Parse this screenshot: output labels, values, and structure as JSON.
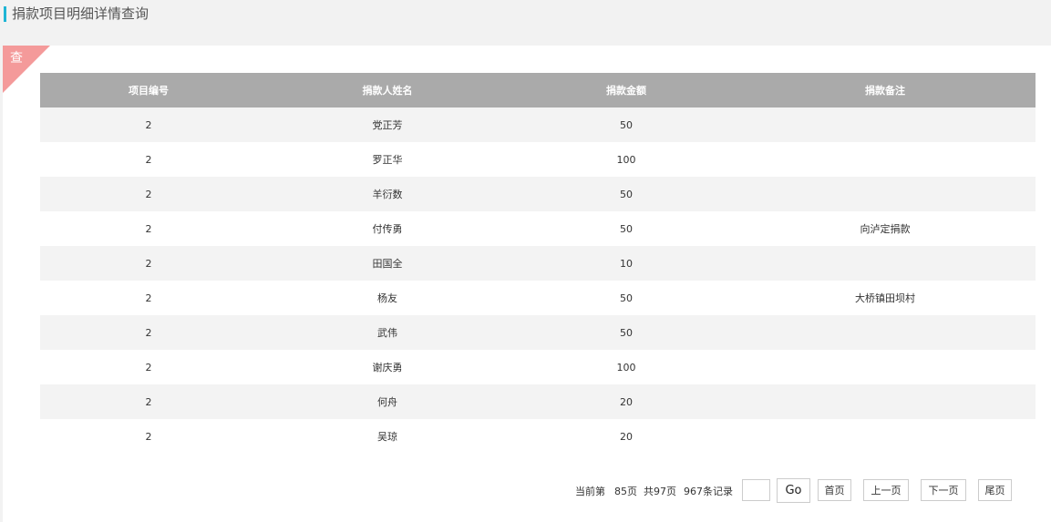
{
  "header": {
    "title": "捐款项目明细详情查询"
  },
  "corner": {
    "label": "查"
  },
  "table": {
    "columns": [
      "项目编号",
      "捐款人姓名",
      "捐款金额",
      "捐款备注"
    ],
    "rows": [
      [
        "2",
        "党正芳",
        "50",
        ""
      ],
      [
        "2",
        "罗正华",
        "100",
        ""
      ],
      [
        "2",
        "羊衍数",
        "50",
        ""
      ],
      [
        "2",
        "付传勇",
        "50",
        "向泸定捐款"
      ],
      [
        "2",
        "田国全",
        "10",
        ""
      ],
      [
        "2",
        "杨友",
        "50",
        "大桥镇田坝村"
      ],
      [
        "2",
        "武伟",
        "50",
        ""
      ],
      [
        "2",
        "谢庆勇",
        "100",
        ""
      ],
      [
        "2",
        "何舟",
        "20",
        ""
      ],
      [
        "2",
        "吴琼",
        "20",
        ""
      ]
    ]
  },
  "pager": {
    "current_prefix": "当前第",
    "current_page": "85页",
    "total_pages": "共97页",
    "total_records": "967条记录",
    "input_value": "",
    "go_label": "Go",
    "first_label": "首页",
    "prev_label": "上一页",
    "next_label": "下一页",
    "last_label": "尾页"
  },
  "colors": {
    "accent": "#1fb5d5",
    "corner": "#f49a9a",
    "table_header": "#aaaaaa"
  }
}
